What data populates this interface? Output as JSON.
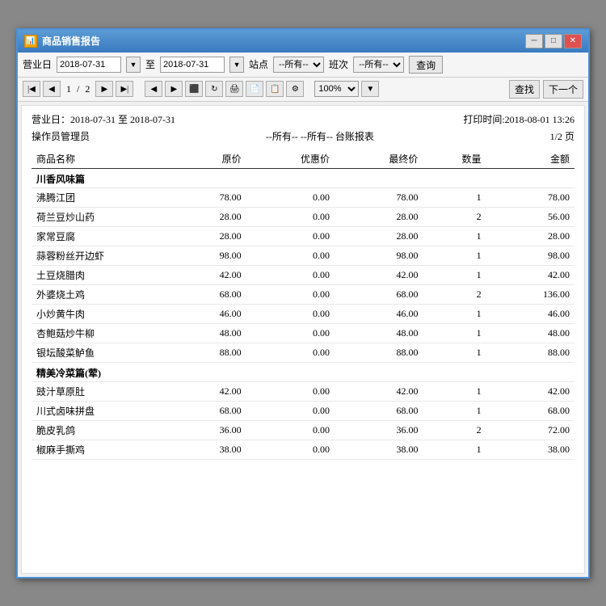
{
  "window": {
    "title": "商品销售报告",
    "icon": "📊"
  },
  "toolbar": {
    "label_date": "营业日",
    "date_from": "2018-07-31",
    "date_to": "2018-07-31",
    "to_label": "至",
    "station_label": "站点",
    "station_placeholder": "--所有--",
    "shift_label": "班次",
    "shift_placeholder": "--所有--",
    "query_label": "查询"
  },
  "nav": {
    "page_current": "1",
    "page_total": "2",
    "zoom": "100%",
    "find_label": "查找",
    "next_label": "下一个"
  },
  "report": {
    "date_range": "营业日：2018-07-31 至 2018-07-31",
    "print_time": "打印时间:2018-08-01 13:26",
    "operator": "操作员管理员",
    "filter": "--所有-- --所有-- 台账报表",
    "page_info": "1/2 页",
    "columns": [
      "商品名称",
      "原价",
      "优惠价",
      "最终价",
      "数量",
      "金额"
    ],
    "categories": [
      {
        "name": "川香风味篇",
        "items": [
          {
            "name": "沸腾江团",
            "original": "78.00",
            "discount": "0.00",
            "final": "78.00",
            "qty": "1",
            "amount": "78.00"
          },
          {
            "name": "荷兰豆炒山药",
            "original": "28.00",
            "discount": "0.00",
            "final": "28.00",
            "qty": "2",
            "amount": "56.00"
          },
          {
            "name": "家常豆腐",
            "original": "28.00",
            "discount": "0.00",
            "final": "28.00",
            "qty": "1",
            "amount": "28.00"
          },
          {
            "name": "蒜蓉粉丝开边虾",
            "original": "98.00",
            "discount": "0.00",
            "final": "98.00",
            "qty": "1",
            "amount": "98.00"
          },
          {
            "name": "土豆烧腊肉",
            "original": "42.00",
            "discount": "0.00",
            "final": "42.00",
            "qty": "1",
            "amount": "42.00"
          },
          {
            "name": "外婆烧土鸡",
            "original": "68.00",
            "discount": "0.00",
            "final": "68.00",
            "qty": "2",
            "amount": "136.00"
          },
          {
            "name": "小炒黄牛肉",
            "original": "46.00",
            "discount": "0.00",
            "final": "46.00",
            "qty": "1",
            "amount": "46.00"
          },
          {
            "name": "杏鲍菇炒牛柳",
            "original": "48.00",
            "discount": "0.00",
            "final": "48.00",
            "qty": "1",
            "amount": "48.00"
          },
          {
            "name": "银坛酸菜鲈鱼",
            "original": "88.00",
            "discount": "0.00",
            "final": "88.00",
            "qty": "1",
            "amount": "88.00"
          }
        ]
      },
      {
        "name": "精美冷菜篇(荤)",
        "items": [
          {
            "name": "豉汁草原肚",
            "original": "42.00",
            "discount": "0.00",
            "final": "42.00",
            "qty": "1",
            "amount": "42.00"
          },
          {
            "name": "川式卤味拼盘",
            "original": "68.00",
            "discount": "0.00",
            "final": "68.00",
            "qty": "1",
            "amount": "68.00"
          },
          {
            "name": "脆皮乳鸽",
            "original": "36.00",
            "discount": "0.00",
            "final": "36.00",
            "qty": "2",
            "amount": "72.00"
          },
          {
            "name": "椒麻手撕鸡",
            "original": "38.00",
            "discount": "0.00",
            "final": "38.00",
            "qty": "1",
            "amount": "38.00"
          }
        ]
      }
    ]
  },
  "title_controls": {
    "minimize": "─",
    "restore": "□",
    "close": "✕"
  }
}
